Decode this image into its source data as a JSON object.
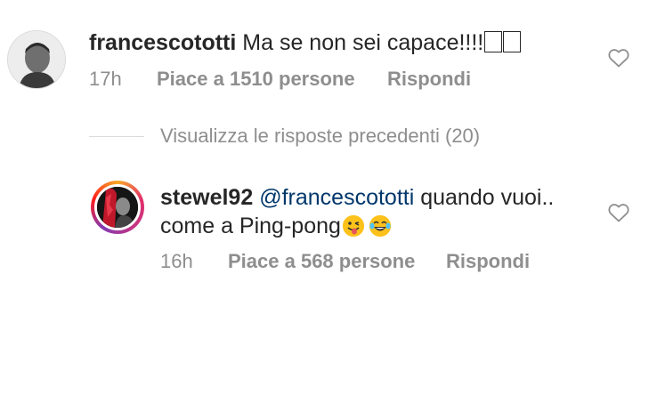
{
  "comments": [
    {
      "username": "francescototti",
      "text": "Ma se non sei capace!!!!",
      "time": "17h",
      "likes": "Piace a 1510 persone",
      "reply": "Rispondi"
    },
    {
      "username": "stewel92",
      "mention": "@francescototti",
      "text_line1": "quando vuoi..",
      "text_line2": "come a Ping-pong",
      "time": "16h",
      "likes": "Piace a 568 persone",
      "reply": "Rispondi"
    }
  ],
  "view_replies": "Visualizza le risposte precedenti (20)",
  "emojis": [
    "unsupported-glyph-box",
    "unsupported-glyph-box",
    "winking-tongue-emoji",
    "tears-of-joy-emoji"
  ],
  "icons": [
    "heart-outline-icon"
  ],
  "colors": {
    "text": "#262626",
    "meta": "#8e8e8e",
    "mention": "#00376b",
    "divider": "#dbdbdb"
  }
}
